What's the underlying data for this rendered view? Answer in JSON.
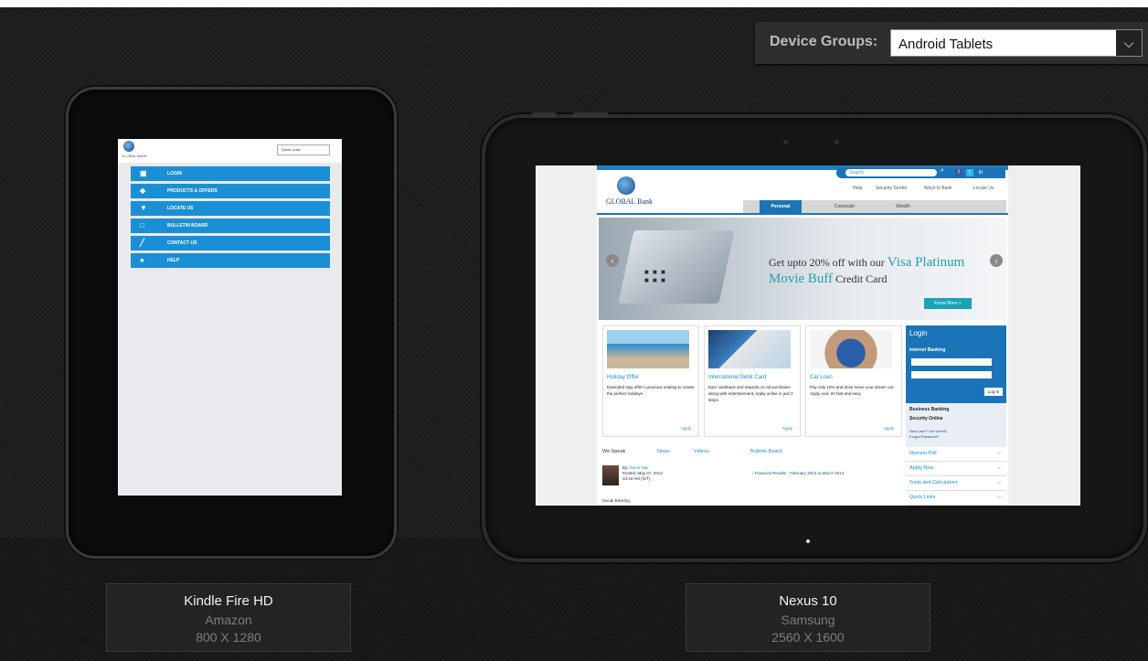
{
  "device_groups": {
    "label": "Device Groups:",
    "selected": "Android Tablets"
  },
  "devices": [
    {
      "name": "Kindle Fire HD",
      "maker": "Amazon",
      "resolution": "800 X 1280"
    },
    {
      "name": "Nexus 10",
      "maker": "Samsung",
      "resolution": "2560 X 1600"
    }
  ],
  "kindle_screen": {
    "bank_name": "GLOBAL BANK",
    "quick_links": "Quick Links",
    "menu": [
      {
        "label": "LOGIN",
        "icon": "lock-icon"
      },
      {
        "label": "PRODUCTS & OFFERS",
        "icon": "tag-icon"
      },
      {
        "label": "LOCATE US",
        "icon": "map-pin-icon"
      },
      {
        "label": "BULLETIN BOARD",
        "icon": "board-icon"
      },
      {
        "label": "CONTACT US",
        "icon": "pencil-icon"
      },
      {
        "label": "HELP",
        "icon": "help-icon"
      }
    ]
  },
  "nexus_screen": {
    "search_placeholder": "Search",
    "bank_name": "GLOBAL Bank",
    "utility_links": [
      "Help",
      "Security Center",
      "Ways to Bank",
      "Locate Us"
    ],
    "tabs": [
      "Personal",
      "Corporate",
      "Wealth"
    ],
    "active_tab": "Personal",
    "banner": {
      "line1": "Get upto 20% off with our ",
      "highlight1": "Visa Platinum",
      "highlight2": "Movie Buff",
      "line2": " Credit Card",
      "button": "Know More »"
    },
    "cards": [
      {
        "title": "Holiday Offer",
        "text": "Extended stay offer! Luxurious seating to create the perfect holidays.",
        "apply": "Apply"
      },
      {
        "title": "International Debit Card",
        "text": "Earn cashback and rewards on all purchases along with entertainment. Apply online in just 3 steps.",
        "apply": "Apply"
      },
      {
        "title": "Car Loan",
        "text": "Pay only 10% and drive home your dream car. Apply now. Its fast and easy",
        "apply": "Apply"
      }
    ],
    "login": {
      "title": "Login",
      "section": "Internet Banking",
      "button": "Log In",
      "links": [
        "Business Banking",
        "Security Online",
        "New User? Get UserID",
        "Forgot Password?"
      ]
    },
    "side_list": [
      "Opinion Poll",
      "Apply Now",
      "Tools and Calculators",
      "Quick Links"
    ],
    "bottom_tabs": [
      "We Speak",
      "News",
      "Videos",
      "Bulletin Board"
    ],
    "post": {
      "by_label": "By:",
      "author": "Sumit Nair",
      "posted": "Posted: May 07, 2013",
      "time": "10:19 AM (IST)",
      "footer": "Social Banking"
    },
    "bulletin_item": "Financial Results - February 2013 to March 2013"
  }
}
